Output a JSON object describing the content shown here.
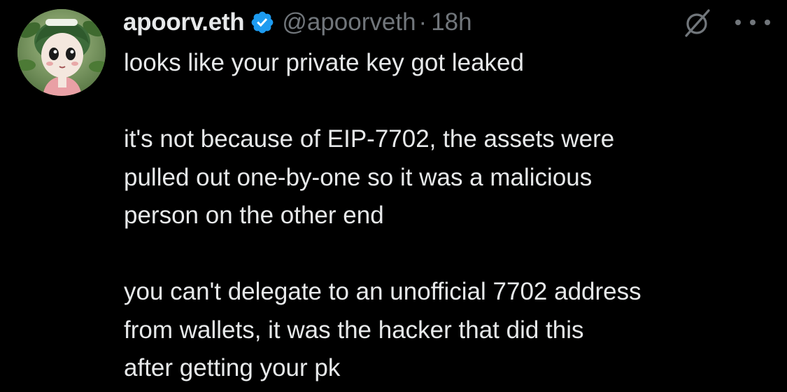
{
  "author": {
    "display_name": "apoorv.eth",
    "handle": "@apoorveth",
    "separator": "·",
    "time": "18h",
    "verified": true
  },
  "icons": {
    "avatar": "avatar-icon",
    "verified": "verified-badge-icon",
    "grok": "grok-icon",
    "more": "more-options-icon"
  },
  "colors": {
    "background": "#000000",
    "text": "#e7e9ea",
    "muted": "#71767b",
    "verified_blue": "#1d9bf0"
  },
  "tweet": {
    "paragraphs": [
      [
        "looks like your private key got leaked"
      ],
      [
        "it's not because of EIP-7702, the assets were",
        "pulled out one-by-one so it was a malicious",
        "person on the other end"
      ],
      [
        "you can't delegate to an unofficial 7702 address",
        "from wallets, it was the hacker that did this",
        "after getting your pk"
      ]
    ]
  }
}
